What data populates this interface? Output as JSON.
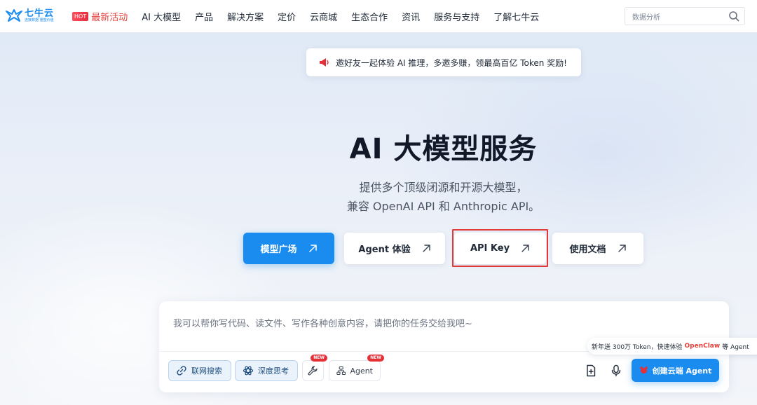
{
  "brand": {
    "name": "七牛云",
    "tagline": "连接数据·重塑价值",
    "accent_color": "#1a8cf0"
  },
  "nav": {
    "hot_badge": "HOT",
    "items": [
      {
        "label": "最新活动",
        "hot": true
      },
      {
        "label": "AI 大模型"
      },
      {
        "label": "产品"
      },
      {
        "label": "解决方案"
      },
      {
        "label": "定价"
      },
      {
        "label": "云商城"
      },
      {
        "label": "生态合作"
      },
      {
        "label": "资讯"
      },
      {
        "label": "服务与支持"
      },
      {
        "label": "了解七牛云"
      }
    ],
    "search_placeholder": "数据分析",
    "search_icon": "search-icon"
  },
  "announcement": {
    "icon": "megaphone-icon",
    "text": "邀好友一起体验 AI 推理，多邀多赚，领最高百亿 Token 奖励!"
  },
  "hero": {
    "title": "AI 大模型服务",
    "subtitle_line1": "提供多个顶级闭源和开源大模型，",
    "subtitle_line2": "兼容 OpenAI API 和 Anthropic API。"
  },
  "buttons": {
    "model_square": "模型广场",
    "agent_trial": "Agent 体验",
    "api_key": "API Key",
    "docs": "使用文档",
    "arrow_icon": "arrow-up-right-icon"
  },
  "chat": {
    "placeholder": "我可以帮你写代码、读文件、写作各种创意内容，请把你的任务交给我吧~",
    "tools": {
      "web_search": "联网搜索",
      "deep_think": "深度思考",
      "agent": "Agent",
      "new_badge": "NEW"
    },
    "create_button": "创建云端 Agent",
    "promo_prefix": "新年送 300万 Token，快速体验",
    "promo_highlight": "OpenClaw",
    "promo_suffix": "等 Agent"
  },
  "colors": {
    "hot_red": "#e5403a",
    "highlight_border": "#e03a3a",
    "primary_blue": "#1a8cf0"
  }
}
